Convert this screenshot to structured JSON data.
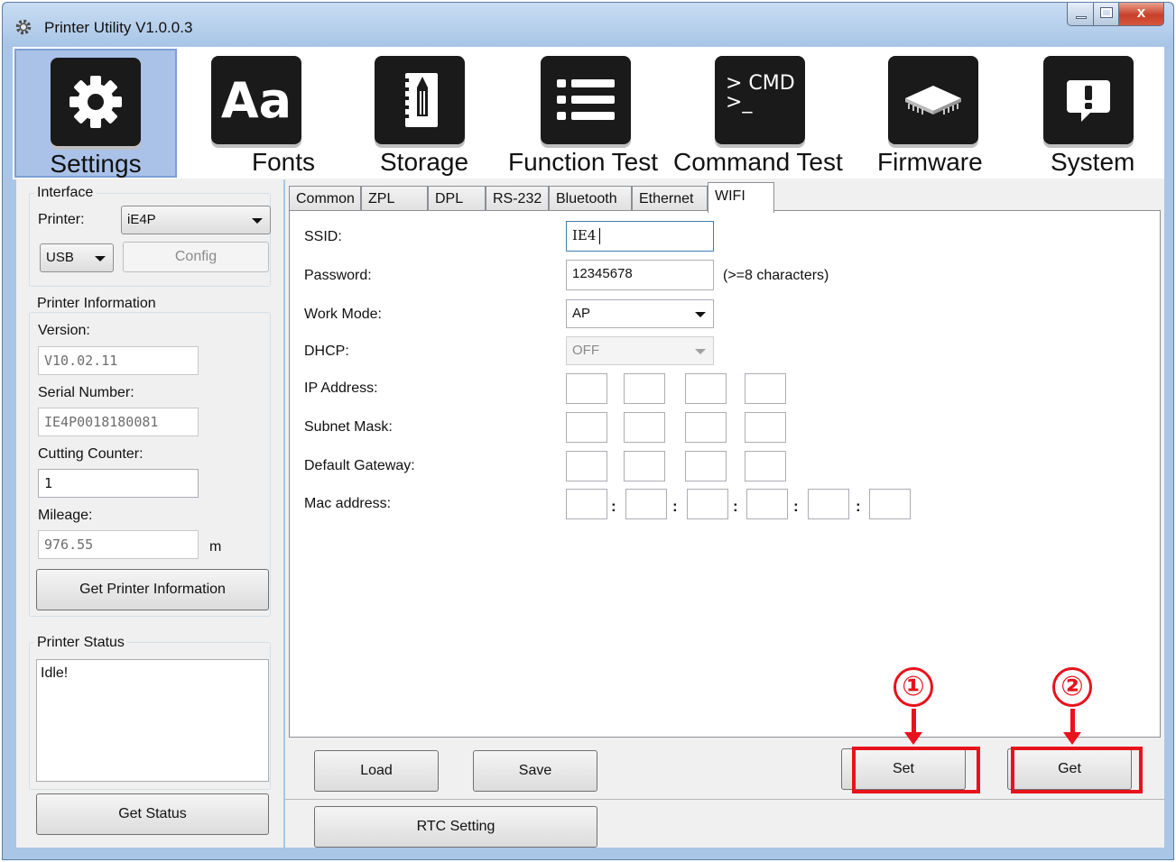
{
  "window": {
    "title": "Printer Utility  V1.0.0.3",
    "close_glyph": "x"
  },
  "toolbar": {
    "items": [
      {
        "label": "Settings",
        "icon": "gear-icon",
        "active": true
      },
      {
        "label": "Fonts",
        "icon": "font-aa-icon",
        "icon_text": "Aa"
      },
      {
        "label": "Storage",
        "icon": "notebook-icon"
      },
      {
        "label": "Function Test",
        "icon": "list-icon"
      },
      {
        "label": "Command Test",
        "icon": "cmd-prompt-icon",
        "icon_text_1": "> CMD",
        "icon_text_2": ">_"
      },
      {
        "label": "Firmware",
        "icon": "chip-icon"
      },
      {
        "label": "System",
        "icon": "alert-icon"
      }
    ]
  },
  "interface": {
    "group_title": "Interface",
    "printer_label": "Printer:",
    "printer_value": "iE4P",
    "port_value": "USB",
    "config_label": "Config"
  },
  "printer_info": {
    "group_title": "Printer Information",
    "version_label": "Version:",
    "version_value": "V10.02.11",
    "serial_label": "Serial Number:",
    "serial_value": "IE4P0018180081",
    "cutting_label": "Cutting Counter:",
    "cutting_value": "1",
    "mileage_label": "Mileage:",
    "mileage_value": "976.55",
    "mileage_unit": "m",
    "get_info_label": "Get Printer Information"
  },
  "printer_status": {
    "group_title": "Printer Status",
    "status_text": "Idle!",
    "get_status_label": "Get Status"
  },
  "tabs": [
    "Common",
    "ZPL",
    "DPL",
    "RS-232",
    "Bluetooth",
    "Ethernet",
    "WIFI"
  ],
  "active_tab": "WIFI",
  "wifi": {
    "ssid_label": "SSID:",
    "ssid_value": "IE4",
    "password_label": "Password:",
    "password_value": "12345678",
    "password_hint": "(>=8 characters)",
    "work_mode_label": "Work Mode:",
    "work_mode_value": "AP",
    "dhcp_label": "DHCP:",
    "dhcp_value": "OFF",
    "ip_label": "IP Address:",
    "subnet_label": "Subnet Mask:",
    "gateway_label": "Default Gateway:",
    "mac_label": "Mac address:",
    "mac_separator": ":"
  },
  "buttons": {
    "load": "Load",
    "save": "Save",
    "set": "Set",
    "get": "Get",
    "rtc": "RTC Setting"
  },
  "annotations": {
    "callout_1": "①",
    "callout_2": "②",
    "highlight_color": "#e8121c"
  }
}
